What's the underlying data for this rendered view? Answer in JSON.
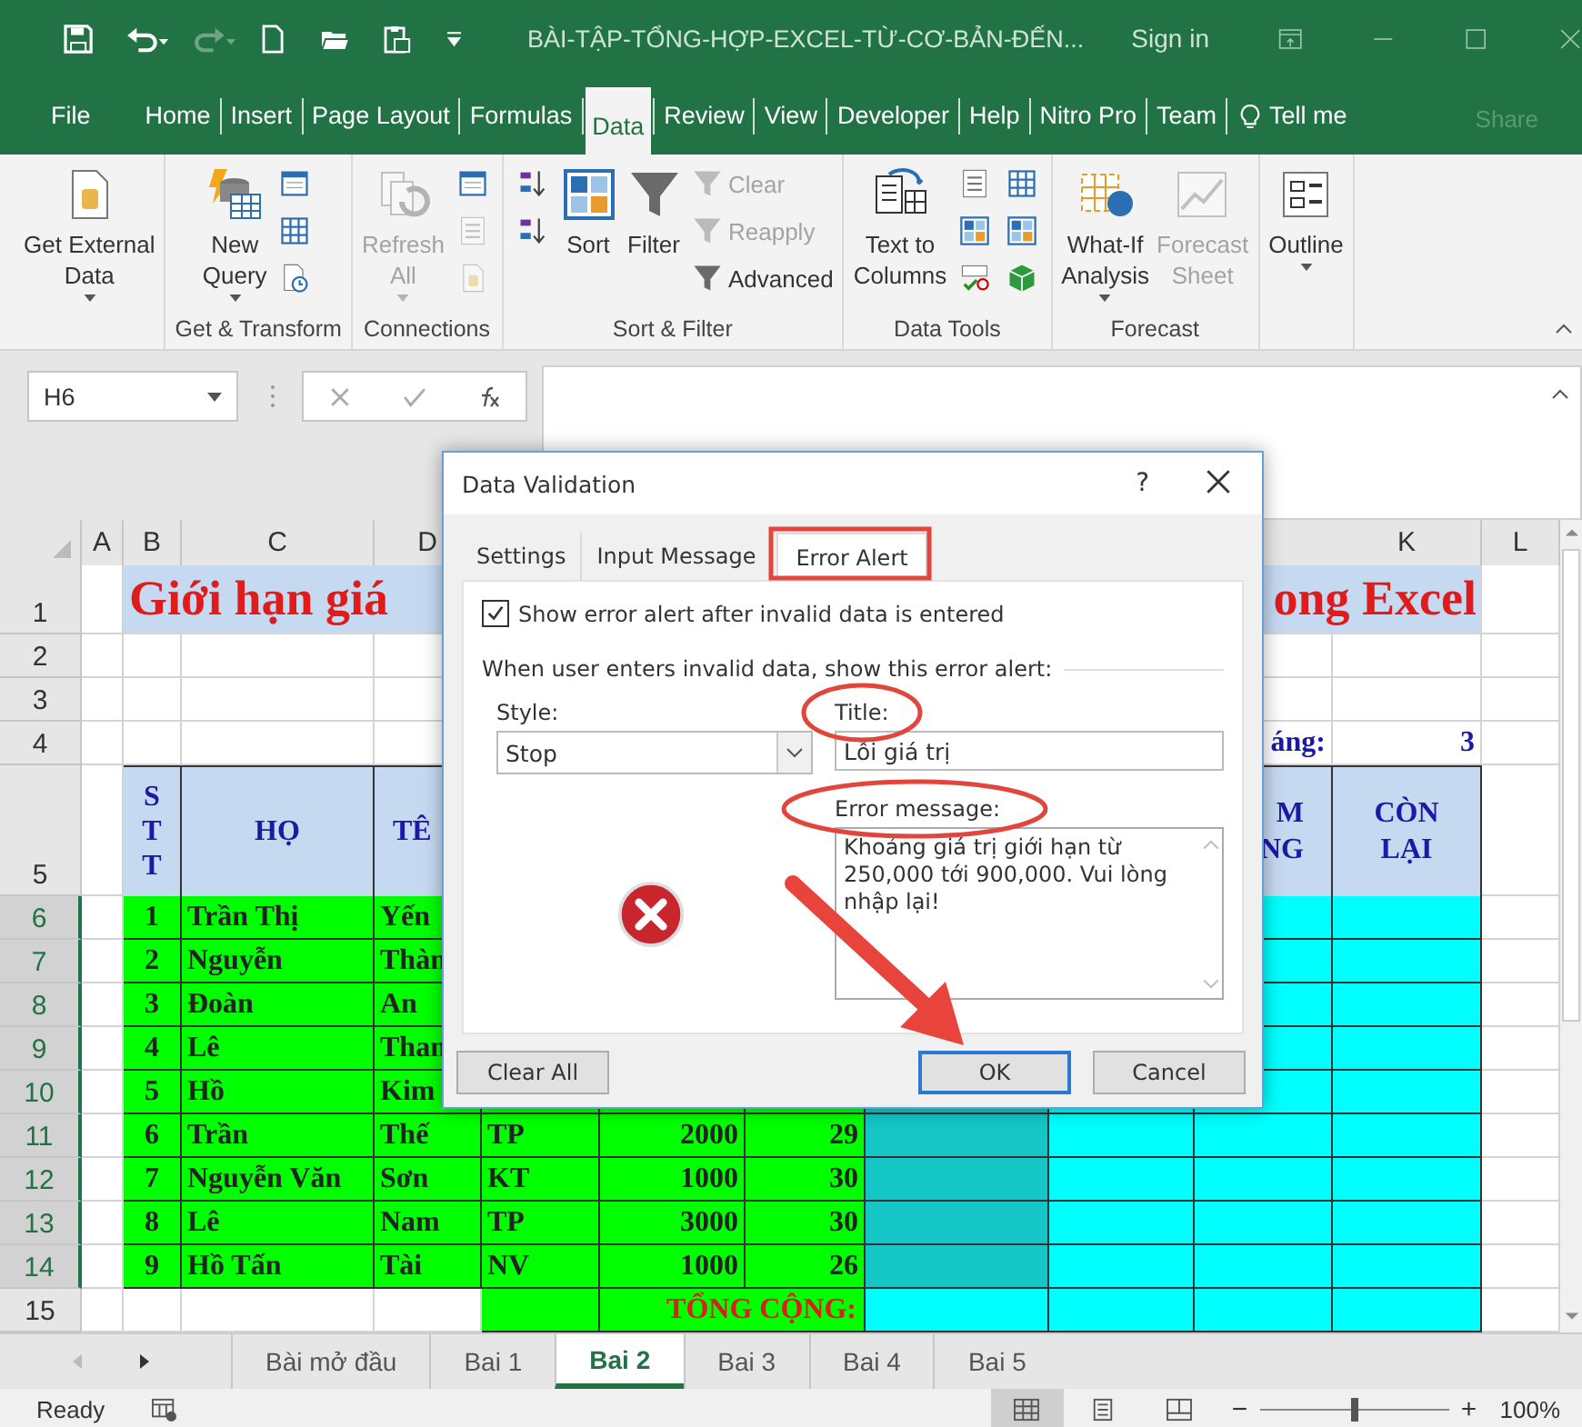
{
  "title_bar": {
    "title": "BÀI-TẬP-TỔNG-HỢP-EXCEL-TỪ-CƠ-BẢN-ĐẾN...",
    "sign_in": "Sign in"
  },
  "menu": [
    {
      "label": "File",
      "selected": false
    },
    {
      "label": "Home",
      "selected": false
    },
    {
      "label": "Insert",
      "selected": false
    },
    {
      "label": "Page Layout",
      "selected": false
    },
    {
      "label": "Formulas",
      "selected": false
    },
    {
      "label": "Data",
      "selected": true
    },
    {
      "label": "Review",
      "selected": false
    },
    {
      "label": "View",
      "selected": false
    },
    {
      "label": "Developer",
      "selected": false
    },
    {
      "label": "Help",
      "selected": false
    },
    {
      "label": "Nitro Pro",
      "selected": false
    },
    {
      "label": "Team",
      "selected": false
    }
  ],
  "tell_me": "Tell me",
  "share": "Share",
  "ribbon": [
    {
      "items": [
        {
          "kind": "large",
          "label": "Get External\nData",
          "dropdown": true,
          "disabled": false
        }
      ]
    },
    {
      "label": "Get & Transform",
      "items": [
        {
          "kind": "large",
          "label": "New\nQuery",
          "dropdown": true,
          "disabled": false
        },
        {
          "kind": "icon",
          "disabled": false
        },
        {
          "kind": "icon",
          "disabled": false
        },
        {
          "kind": "icon",
          "disabled": false
        }
      ]
    },
    {
      "label": "Connections",
      "items": [
        {
          "kind": "large",
          "label": "Refresh\nAll",
          "dropdown": true,
          "disabled": true
        },
        {
          "kind": "icon",
          "disabled": false
        },
        {
          "kind": "icon",
          "disabled": true
        },
        {
          "kind": "icon",
          "disabled": true
        }
      ]
    },
    {
      "label": "Sort & Filter",
      "items": [
        {
          "kind": "icon",
          "disabled": false
        },
        {
          "kind": "icon",
          "disabled": false
        },
        {
          "kind": "spacer"
        },
        {
          "kind": "large",
          "label": "Sort",
          "dropdown": false,
          "disabled": false
        },
        {
          "kind": "large",
          "label": "Filter",
          "dropdown": false,
          "disabled": false
        },
        {
          "kind": "small",
          "label": "Clear",
          "disabled": true
        },
        {
          "kind": "small",
          "label": "Reapply",
          "disabled": true
        },
        {
          "kind": "small",
          "label": "Advanced",
          "disabled": false
        }
      ]
    },
    {
      "label": "Data Tools",
      "items": [
        {
          "kind": "large",
          "label": "Text to\nColumns",
          "dropdown": false,
          "disabled": false
        },
        {
          "kind": "icon",
          "disabled": false
        },
        {
          "kind": "icon",
          "disabled": false
        },
        {
          "kind": "icon",
          "disabled": false
        },
        {
          "kind": "icon",
          "disabled": false
        },
        {
          "kind": "icon",
          "disabled": false
        },
        {
          "kind": "icon",
          "disabled": false
        }
      ]
    },
    {
      "label": "Forecast",
      "items": [
        {
          "kind": "large",
          "label": "What-If\nAnalysis",
          "dropdown": true,
          "disabled": false
        },
        {
          "kind": "large",
          "label": "Forecast\nSheet",
          "dropdown": false,
          "disabled": true
        }
      ]
    },
    {
      "items": [
        {
          "kind": "large",
          "label": "Outline",
          "dropdown": true,
          "disabled": false
        }
      ]
    }
  ],
  "formula_bar": {
    "name_box": "H6"
  },
  "sheet": {
    "columns": [
      "A",
      "B",
      "C",
      "D",
      "K",
      "L"
    ],
    "rows": [
      {
        "number": "1",
        "kind": "title",
        "selected": false,
        "texts": [
          "Giới hạn giá",
          "ong Excel"
        ]
      },
      {
        "number": "2",
        "kind": "blank",
        "selected": false
      },
      {
        "number": "3",
        "kind": "blank",
        "selected": false
      },
      {
        "number": "4",
        "kind": "label",
        "selected": false,
        "texts": [
          "áng:",
          "3"
        ]
      },
      {
        "number": "5",
        "kind": "header",
        "selected": false,
        "texts": [
          "S\nT\nT",
          "HỌ",
          "TÊ",
          "M\nNG",
          "CÒN\nLẠI"
        ]
      },
      {
        "number": "6",
        "kind": "data",
        "selected": true,
        "texts": [
          "1",
          "Trần Thị",
          "Yến"
        ]
      },
      {
        "number": "7",
        "kind": "data",
        "selected": true,
        "texts": [
          "2",
          "Nguyễn",
          "Thàn"
        ]
      },
      {
        "number": "8",
        "kind": "data",
        "selected": true,
        "texts": [
          "3",
          "Đoàn",
          "An"
        ]
      },
      {
        "number": "9",
        "kind": "data",
        "selected": true,
        "texts": [
          "4",
          "Lê",
          "Than"
        ]
      },
      {
        "number": "10",
        "kind": "data",
        "selected": true,
        "texts": [
          "5",
          "Hồ",
          "Kim"
        ]
      },
      {
        "number": "11",
        "kind": "data",
        "selected": true,
        "texts": [
          "6",
          "Trần",
          "Thế",
          "TP",
          "2000",
          "29"
        ]
      },
      {
        "number": "12",
        "kind": "data",
        "selected": true,
        "texts": [
          "7",
          "Nguyễn Văn",
          "Sơn",
          "KT",
          "1000",
          "30"
        ]
      },
      {
        "number": "13",
        "kind": "data",
        "selected": true,
        "texts": [
          "8",
          "Lê",
          "Nam",
          "TP",
          "3000",
          "30"
        ]
      },
      {
        "number": "14",
        "kind": "data",
        "selected": true,
        "texts": [
          "9",
          "Hồ Tấn",
          "Tài",
          "NV",
          "1000",
          "26"
        ]
      },
      {
        "number": "15",
        "kind": "total",
        "selected": false,
        "texts": [
          "TỔNG CỘNG:"
        ]
      }
    ]
  },
  "dialog": {
    "title": "Data Validation",
    "help": "?",
    "tabs": [
      {
        "label": "Settings",
        "selected": false
      },
      {
        "label": "Input Message",
        "selected": false
      },
      {
        "label": "Error Alert",
        "selected": true
      }
    ],
    "show_alert": {
      "label": "Show error alert after invalid data is entered",
      "checked": true
    },
    "section_label": "When user enters invalid data, show this error alert:",
    "style": {
      "label": "Style:",
      "value": "Stop"
    },
    "title_field": {
      "label": "Title:",
      "value": "Lỗi giá trị"
    },
    "message_field": {
      "label": "Error message:",
      "value": "Khoảng giá trị giới hạn từ 250,000 tới 900,000. Vui lòng nhập lại!"
    },
    "buttons": [
      {
        "label": "Clear All",
        "kind": "plain"
      },
      {
        "label": "OK",
        "kind": "default"
      },
      {
        "label": "Cancel",
        "kind": "plain"
      }
    ]
  },
  "sheet_tabs": [
    {
      "label": "Bài mở đầu",
      "selected": false
    },
    {
      "label": "Bai 1",
      "selected": false
    },
    {
      "label": "Bai 2",
      "selected": true
    },
    {
      "label": "Bai 3",
      "selected": false
    },
    {
      "label": "Bai 4",
      "selected": false
    },
    {
      "label": "Bai 5",
      "selected": false
    }
  ],
  "status_bar": {
    "text": "Ready",
    "view_buttons": [
      {
        "selected": true
      },
      {
        "selected": false
      },
      {
        "selected": false
      }
    ],
    "zoom_out": "−",
    "zoom_in": "+",
    "zoom": {
      "level": 0.5,
      "reading": "100%"
    }
  }
}
